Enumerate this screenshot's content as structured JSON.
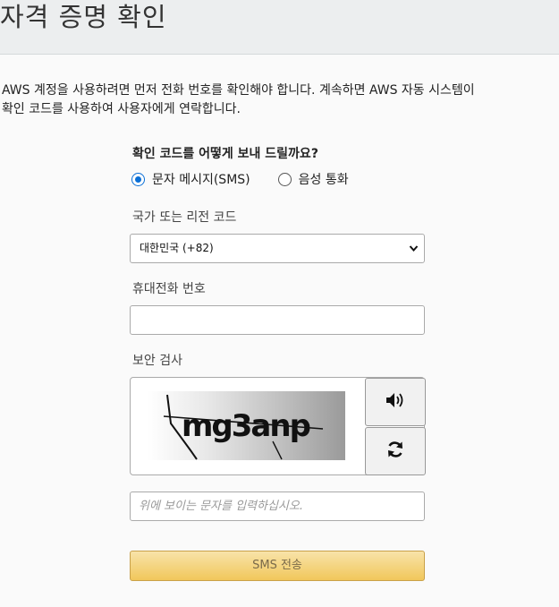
{
  "header": {
    "title": "자격 증명 확인"
  },
  "intro": {
    "line1": "AWS 계정을 사용하려면 먼저 전화 번호를 확인해야 합니다. 계속하면 AWS 자동 시스템이",
    "line2": "확인 코드를 사용하여 사용자에게 연락합니다."
  },
  "form": {
    "question": "확인 코드를 어떻게 보내 드릴까요?",
    "options": [
      {
        "label": "문자 메시지(SMS)",
        "selected": true
      },
      {
        "label": "음성 통화",
        "selected": false
      }
    ],
    "country_label": "국가 또는 리전 코드",
    "country_value": "대한민국 (+82)",
    "phone_label": "휴대전화 번호",
    "phone_value": "",
    "security_label": "보안 검사",
    "captcha_text": "mg3anp",
    "captcha_placeholder": "위에 보이는 문자를 입력하십시오.",
    "submit_label": "SMS 전송"
  },
  "icons": {
    "audio": "speaker-icon",
    "refresh": "refresh-icon",
    "dropdown": "chevron-down-icon"
  },
  "colors": {
    "accent": "#0a6fd6",
    "button_top": "#f8e3a9",
    "button_bottom": "#f1c75b",
    "header_bg": "#eceeef"
  }
}
